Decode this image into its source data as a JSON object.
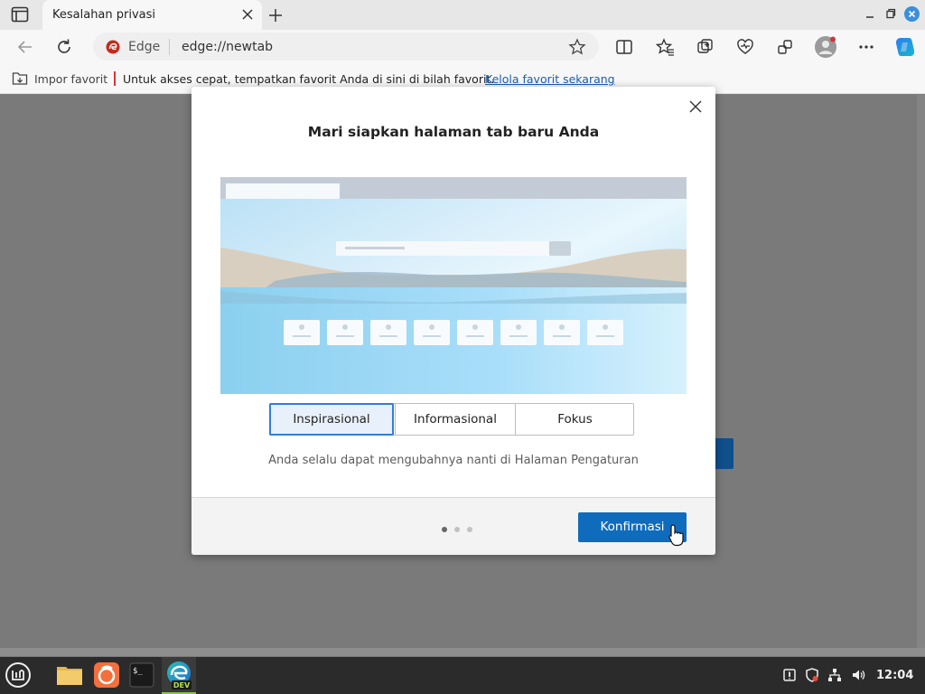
{
  "tab": {
    "title": "Kesalahan privasi"
  },
  "address": {
    "site": "Edge",
    "url": "edge://newtab"
  },
  "favorites_bar": {
    "import_label": "Impor favorit",
    "message": "Untuk akses cepat, tempatkan favorit Anda di sini di bilah favorit.",
    "manage_link": "Kelola favorit sekarang"
  },
  "modal": {
    "title": "Mari siapkan halaman tab baru Anda",
    "options": [
      "Inspirasional",
      "Informasional",
      "Fokus"
    ],
    "selected_option": "Inspirasional",
    "hint": "Anda selalu dapat mengubahnya nanti di Halaman Pengaturan",
    "confirm_label": "Konfirmasi",
    "step_current": 1,
    "step_total": 3
  },
  "taskbar": {
    "clock": "12:04",
    "apps": [
      "menu-icon",
      "files-icon",
      "firefox-icon",
      "terminal-icon",
      "edge-dev-icon"
    ],
    "edge_badge": "DEV"
  },
  "colors": {
    "accent": "#0f6cbd",
    "selected_border": "#2f7ed8",
    "link": "#1a5fb4"
  }
}
